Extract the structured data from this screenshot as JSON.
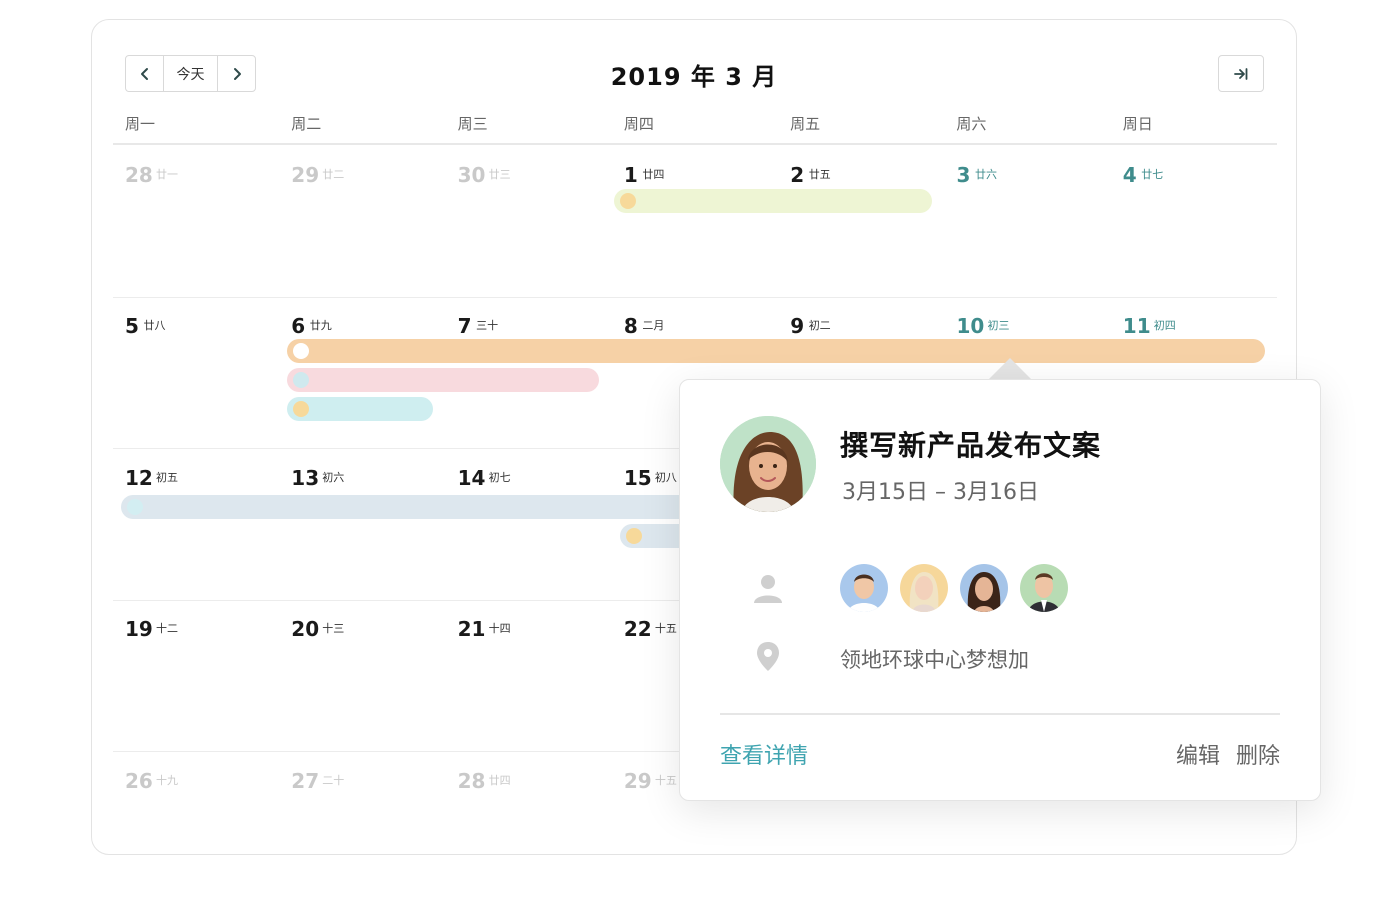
{
  "toolbar": {
    "prev_icon": "chevron-left-icon",
    "today_label": "今天",
    "next_icon": "chevron-right-icon",
    "title": "2019 年 3 月",
    "side_icon": "collapse-right-icon"
  },
  "weekdays": [
    "周一",
    "周二",
    "周三",
    "周四",
    "周五",
    "周六",
    "周日"
  ],
  "weeks": [
    [
      {
        "num": "28",
        "lunar": "廿一",
        "state": "muted"
      },
      {
        "num": "29",
        "lunar": "廿二",
        "state": "muted"
      },
      {
        "num": "30",
        "lunar": "廿三",
        "state": "muted"
      },
      {
        "num": "1",
        "lunar": "廿四",
        "state": "normal"
      },
      {
        "num": "2",
        "lunar": "廿五",
        "state": "normal"
      },
      {
        "num": "3",
        "lunar": "廿六",
        "state": "weekend"
      },
      {
        "num": "4",
        "lunar": "廿七",
        "state": "weekend"
      }
    ],
    [
      {
        "num": "5",
        "lunar": "廿八",
        "state": "normal"
      },
      {
        "num": "6",
        "lunar": "廿九",
        "state": "normal"
      },
      {
        "num": "7",
        "lunar": "三十",
        "state": "normal"
      },
      {
        "num": "8",
        "lunar": "二月",
        "state": "normal"
      },
      {
        "num": "9",
        "lunar": "初二",
        "state": "normal"
      },
      {
        "num": "10",
        "lunar": "初三",
        "state": "weekend"
      },
      {
        "num": "11",
        "lunar": "初四",
        "state": "weekend"
      }
    ],
    [
      {
        "num": "12",
        "lunar": "初五",
        "state": "normal"
      },
      {
        "num": "13",
        "lunar": "初六",
        "state": "normal"
      },
      {
        "num": "14",
        "lunar": "初七",
        "state": "normal"
      },
      {
        "num": "15",
        "lunar": "初八",
        "state": "normal"
      },
      {
        "num": "",
        "lunar": "",
        "state": "normal"
      },
      {
        "num": "",
        "lunar": "",
        "state": "normal"
      },
      {
        "num": "",
        "lunar": "",
        "state": "normal"
      }
    ],
    [
      {
        "num": "19",
        "lunar": "十二",
        "state": "normal"
      },
      {
        "num": "20",
        "lunar": "十三",
        "state": "normal"
      },
      {
        "num": "21",
        "lunar": "十四",
        "state": "normal"
      },
      {
        "num": "22",
        "lunar": "十五",
        "state": "normal"
      },
      {
        "num": "",
        "lunar": "",
        "state": "normal"
      },
      {
        "num": "",
        "lunar": "",
        "state": "normal"
      },
      {
        "num": "",
        "lunar": "",
        "state": "normal"
      }
    ],
    [
      {
        "num": "26",
        "lunar": "十九",
        "state": "muted"
      },
      {
        "num": "27",
        "lunar": "二十",
        "state": "muted"
      },
      {
        "num": "28",
        "lunar": "廿四",
        "state": "muted"
      },
      {
        "num": "29",
        "lunar": "十五",
        "state": "muted"
      },
      {
        "num": "",
        "lunar": "",
        "state": "muted"
      },
      {
        "num": "",
        "lunar": "",
        "state": "muted"
      },
      {
        "num": "",
        "lunar": "",
        "state": "muted"
      }
    ]
  ],
  "colors": {
    "green_bar": "#eef5d4",
    "green_dot": "#f7d99a",
    "orange_bar": "#f6d1a6",
    "orange_dot": "#ffffff",
    "pink_bar": "#f8dade",
    "pink_dot": "#cfe9ee",
    "cyan_bar": "#cfeef0",
    "cyan_dot": "#f7d99a",
    "blue_bar": "#dde7ee",
    "blue_dot": "#d3eef2",
    "blue2_dot": "#f7d99a",
    "accent": "#3fa4b0"
  },
  "popover": {
    "title": "撰写新产品发布文案",
    "date_range": "3月15日 – 3月16日",
    "person_icon": "person-icon",
    "location_icon": "location-pin-icon",
    "location": "领地环球中心梦想加",
    "details_label": "查看详情",
    "edit_label": "编辑",
    "delete_label": "删除"
  }
}
